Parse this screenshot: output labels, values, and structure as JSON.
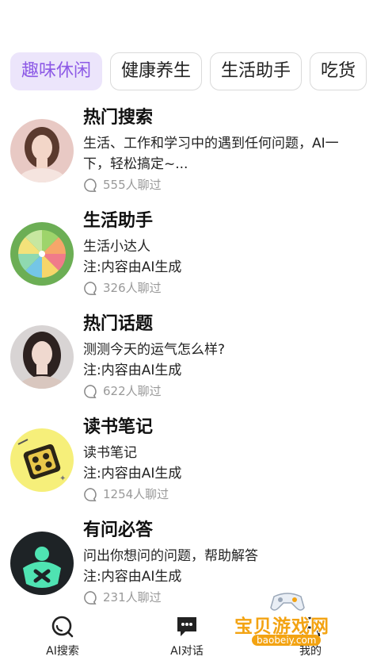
{
  "tabs": [
    {
      "label": "趣味休闲",
      "active": true
    },
    {
      "label": "健康养生",
      "active": false
    },
    {
      "label": "生活助手",
      "active": false
    },
    {
      "label": "吃货",
      "active": false
    }
  ],
  "items": [
    {
      "title": "热门搜索",
      "desc": "生活、工作和学习中的遇到任何问题，AI一下，轻松搞定~...",
      "note": "",
      "count": "555人聊过",
      "avatar": "girl-portrait"
    },
    {
      "title": "生活助手",
      "desc": "生活小达人",
      "note": "注:内容由AI生成",
      "count": "326人聊过",
      "avatar": "fan-icon"
    },
    {
      "title": "热门话题",
      "desc": "测测今天的运气怎么样?",
      "note": "注:内容由AI生成",
      "count": "622人聊过",
      "avatar": "girl-portrait"
    },
    {
      "title": "读书笔记",
      "desc": "读书笔记",
      "note": "注:内容由AI生成",
      "count": "1254人聊过",
      "avatar": "book-icon"
    },
    {
      "title": "有问必答",
      "desc": "问出你想问的问题，帮助解答",
      "note": "注:内容由AI生成",
      "count": "231人聊过",
      "avatar": "robot-icon"
    }
  ],
  "nav": {
    "search_label": "AI搜索",
    "chat_label": "AI对话",
    "mine_label": "我的"
  },
  "watermark": {
    "text": "宝贝游戏网",
    "url": "baobeiy.com"
  },
  "colors": {
    "accent": "#8d5ae6",
    "accent_bg": "#ece5fb",
    "watermark": "#f3a312"
  }
}
